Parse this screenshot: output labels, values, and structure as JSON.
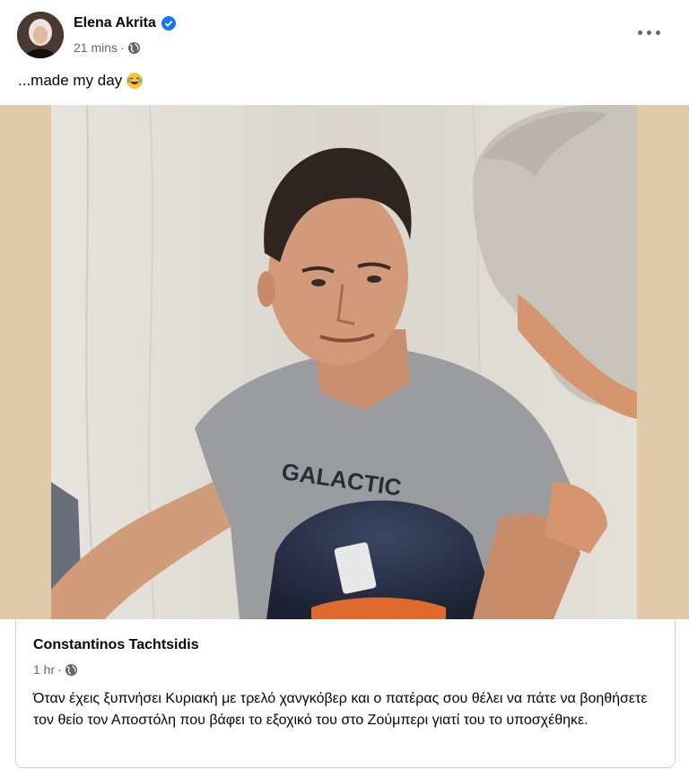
{
  "post": {
    "author": "Elena Akrita",
    "timestamp": "21 mins",
    "separator": "·",
    "privacy_icon": "globe-icon",
    "verified_icon": "verified-badge-icon",
    "caption": "...made my day",
    "caption_emoji": "laughing-tears-emoji",
    "more_icon": "more-options-icon"
  },
  "shared_post": {
    "author": "Constantinos Tachtsidis",
    "timestamp": "1 hr",
    "separator": "·",
    "privacy_icon": "globe-icon",
    "text": "Όταν έχεις ξυπνήσει Κυριακή με τρελό χανγκόβερ και ο πατέρας σου θέλει να πάτε να βοηθήσετε τον θείο τον Αποστόλη που βάφει το εξοχικό του στο Ζούμπερι γιατί του το υποσχέθηκε.",
    "shirt_print": "GALACTIC"
  },
  "colors": {
    "accent": "#1877f2",
    "secondary_text": "#65676b",
    "photo_background": "#dfc9a9"
  }
}
